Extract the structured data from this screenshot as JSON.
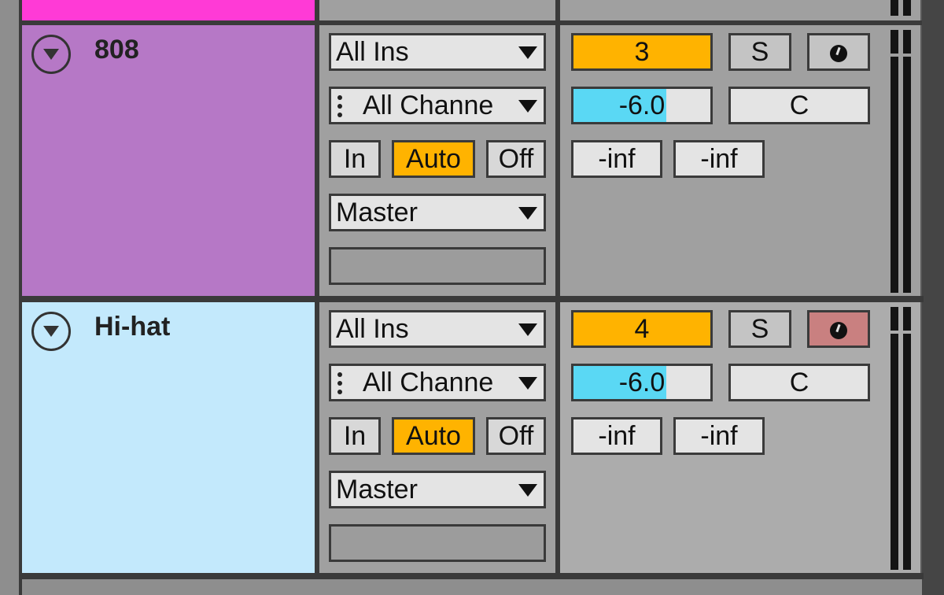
{
  "tracks": [
    {
      "name": "808",
      "color": "#b678c6",
      "input_type": "All Ins",
      "input_channel": "All Channe",
      "monitor": [
        "In",
        "Auto",
        "Off"
      ],
      "monitor_active": "Auto",
      "output": "Master",
      "track_number": "3",
      "solo_label": "S",
      "armed": false,
      "volume": "-6.0",
      "volume_fraction": 0.68,
      "pan": "C",
      "meter_left": "-inf",
      "meter_right": "-inf"
    },
    {
      "name": "Hi-hat",
      "color": "#c3e9fc",
      "input_type": "All Ins",
      "input_channel": "All Channe",
      "monitor": [
        "In",
        "Auto",
        "Off"
      ],
      "monitor_active": "Auto",
      "output": "Master",
      "track_number": "4",
      "solo_label": "S",
      "armed": true,
      "volume": "-6.0",
      "volume_fraction": 0.68,
      "pan": "C",
      "meter_left": "-inf",
      "meter_right": "-inf"
    }
  ],
  "colors": {
    "top_track": "#ff3ad6",
    "activator": "#ffb300",
    "volume_fill": "#5ad8f4",
    "arm_on": "#c98080"
  }
}
